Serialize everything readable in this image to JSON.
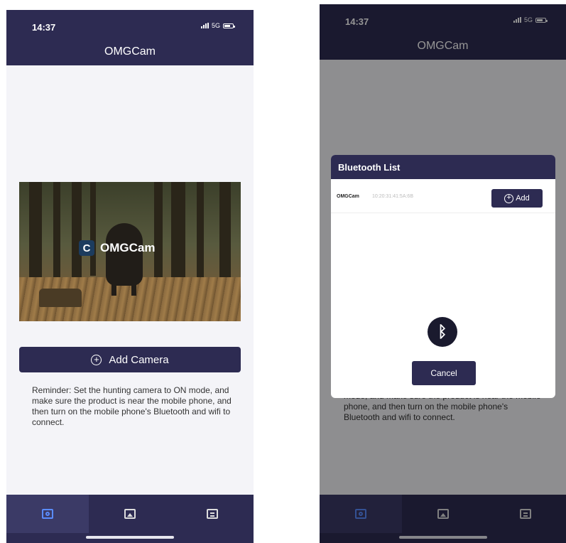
{
  "screen_left": {
    "status": {
      "time": "14:37",
      "network": "5G"
    },
    "app_title": "OMGCam",
    "hero": {
      "brand_text": "OMGCam",
      "logo_glyph": "C"
    },
    "add_camera": {
      "label": "Add Camera",
      "plus": "+"
    },
    "reminder": "Reminder: Set the hunting camera to ON mode,   and make sure the product is near the mobile phone,   and then turn on the mobile phone's Bluetooth and wifi to connect.",
    "tabs": [
      {
        "icon": "camera-icon",
        "active": true
      },
      {
        "icon": "gallery-icon",
        "active": false
      },
      {
        "icon": "clipboard-icon",
        "active": false
      }
    ]
  },
  "screen_right": {
    "status": {
      "time": "14:37",
      "network": "5G"
    },
    "app_title": "OMGCam",
    "dialog": {
      "title": "Bluetooth List",
      "device": {
        "name": "OMGCam",
        "mac": "10:20:31:41:5A:6B"
      },
      "add_label": "Add",
      "plus": "+",
      "bluetooth_glyph": "ᛒ",
      "cancel_label": "Cancel"
    },
    "reminder_visible": "mode,   and make sure the product is near the mobile phone,   and then turn on the mobile phone's Bluetooth and wifi to connect."
  },
  "colors": {
    "brand_navy": "#2d2b52",
    "active_tab": "#3b3a66",
    "active_icon": "#5a8cff"
  }
}
